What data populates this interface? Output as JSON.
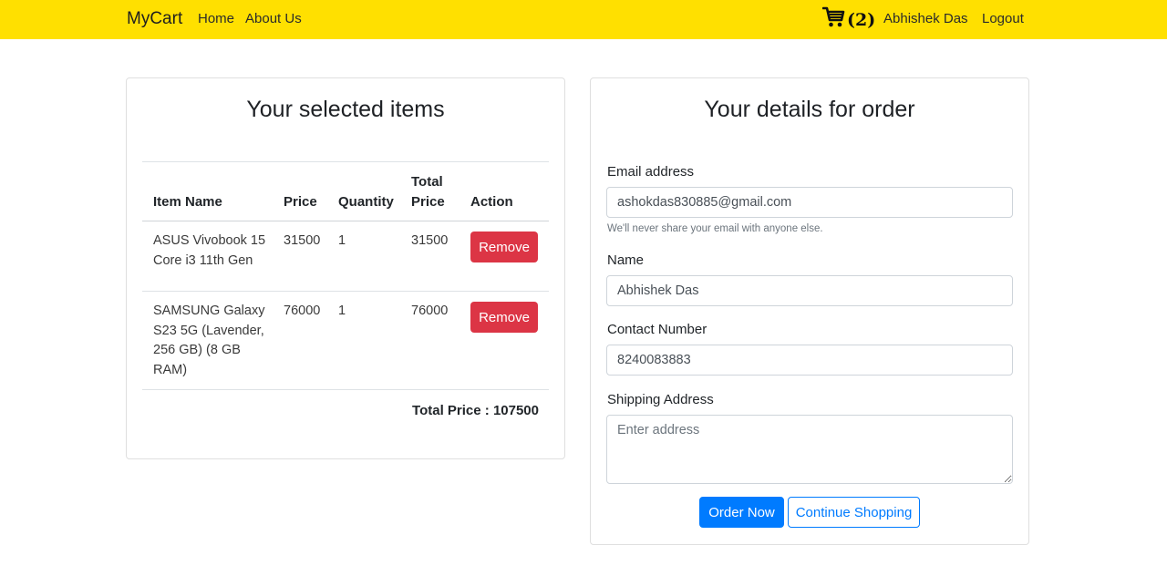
{
  "navbar": {
    "brand": "MyCart",
    "links": [
      "Home",
      "About Us"
    ],
    "cart_count": "(2)",
    "cart_icon": "shopping-cart-icon",
    "user_name": "Abhishek Das",
    "logout": "Logout"
  },
  "cart_panel": {
    "title": "Your selected items",
    "headers": {
      "item_name": "Item Name",
      "price": "Price",
      "quantity": "Quantity",
      "total_price_line1": "Total",
      "total_price_line2": "Price",
      "action": "Action"
    },
    "items": [
      {
        "name": "ASUS Vivobook 15 Core i3 11th Gen",
        "price": "31500",
        "quantity": "1",
        "total": "31500",
        "action": "Remove"
      },
      {
        "name": "SAMSUNG Galaxy S23 5G (Lavender, 256 GB) (8 GB RAM)",
        "price": "76000",
        "quantity": "1",
        "total": "76000",
        "action": "Remove"
      }
    ],
    "total_label": "Total Price : 107500"
  },
  "order_form": {
    "title": "Your details for order",
    "email_label": "Email address",
    "email_value": "ashokdas830885@gmail.com",
    "email_hint": "We'll never share your email with anyone else.",
    "name_label": "Name",
    "name_value": "Abhishek Das",
    "contact_label": "Contact Number",
    "contact_value": "8240083883",
    "address_label": "Shipping Address",
    "address_placeholder": "Enter address",
    "order_button": "Order Now",
    "continue_button": "Continue Shopping"
  },
  "colors": {
    "navbar": "#ffe000",
    "remove": "#dc3545",
    "primary": "#007bff"
  }
}
